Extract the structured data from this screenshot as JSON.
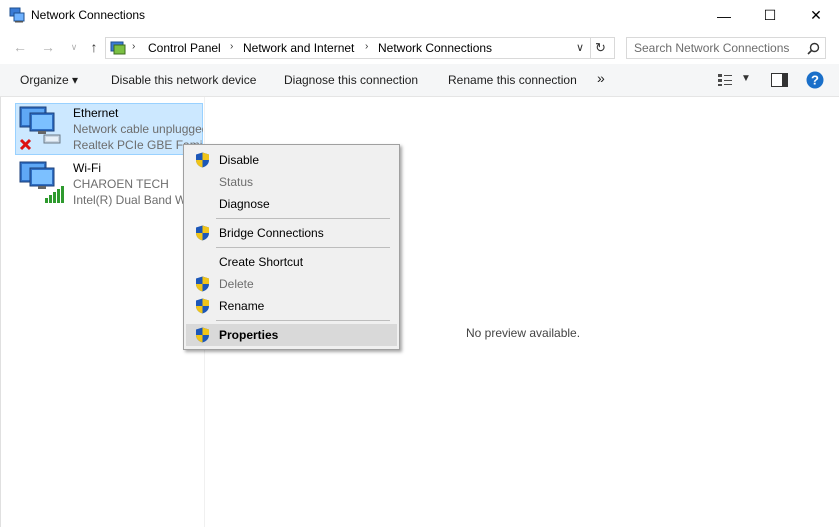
{
  "window": {
    "title": "Network Connections",
    "controls": {
      "minimize": "—",
      "maximize": "☐",
      "close": "✕"
    }
  },
  "nav": {
    "back": "←",
    "forward": "→",
    "recent": "∨",
    "up": "↑",
    "breadcrumb": [
      "Control Panel",
      "Network and Internet",
      "Network Connections"
    ],
    "search_placeholder": "Search Network Connections"
  },
  "commands": {
    "organize": "Organize ▾",
    "disable": "Disable this network device",
    "diagnose": "Diagnose this connection",
    "rename": "Rename this connection",
    "more": "»"
  },
  "connections": [
    {
      "name": "Ethernet",
      "status": "Network cable unplugged",
      "device": "Realtek PCIe GBE Family Controller",
      "icon": "ethernet-disconnected-icon"
    },
    {
      "name": "Wi-Fi",
      "status": "CHAROEN TECH",
      "device": "Intel(R) Dual Band Wireless-AC",
      "icon": "wifi-connected-icon"
    }
  ],
  "preview": "No preview available.",
  "context_menu": {
    "items": [
      {
        "label": "Disable",
        "shield": true,
        "disabled": false
      },
      {
        "label": "Status",
        "shield": false,
        "disabled": true
      },
      {
        "label": "Diagnose",
        "shield": false,
        "disabled": false
      },
      {
        "label": "Bridge Connections",
        "shield": true,
        "disabled": false
      },
      {
        "label": "Create Shortcut",
        "shield": false,
        "disabled": false
      },
      {
        "label": "Delete",
        "shield": true,
        "disabled": true
      },
      {
        "label": "Rename",
        "shield": true,
        "disabled": false
      },
      {
        "label": "Properties",
        "shield": true,
        "disabled": false,
        "default": true,
        "highlighted": true
      }
    ]
  },
  "colors": {
    "selection": "#cce8ff",
    "accent": "#0078d7",
    "help": "#1a6fc9"
  }
}
